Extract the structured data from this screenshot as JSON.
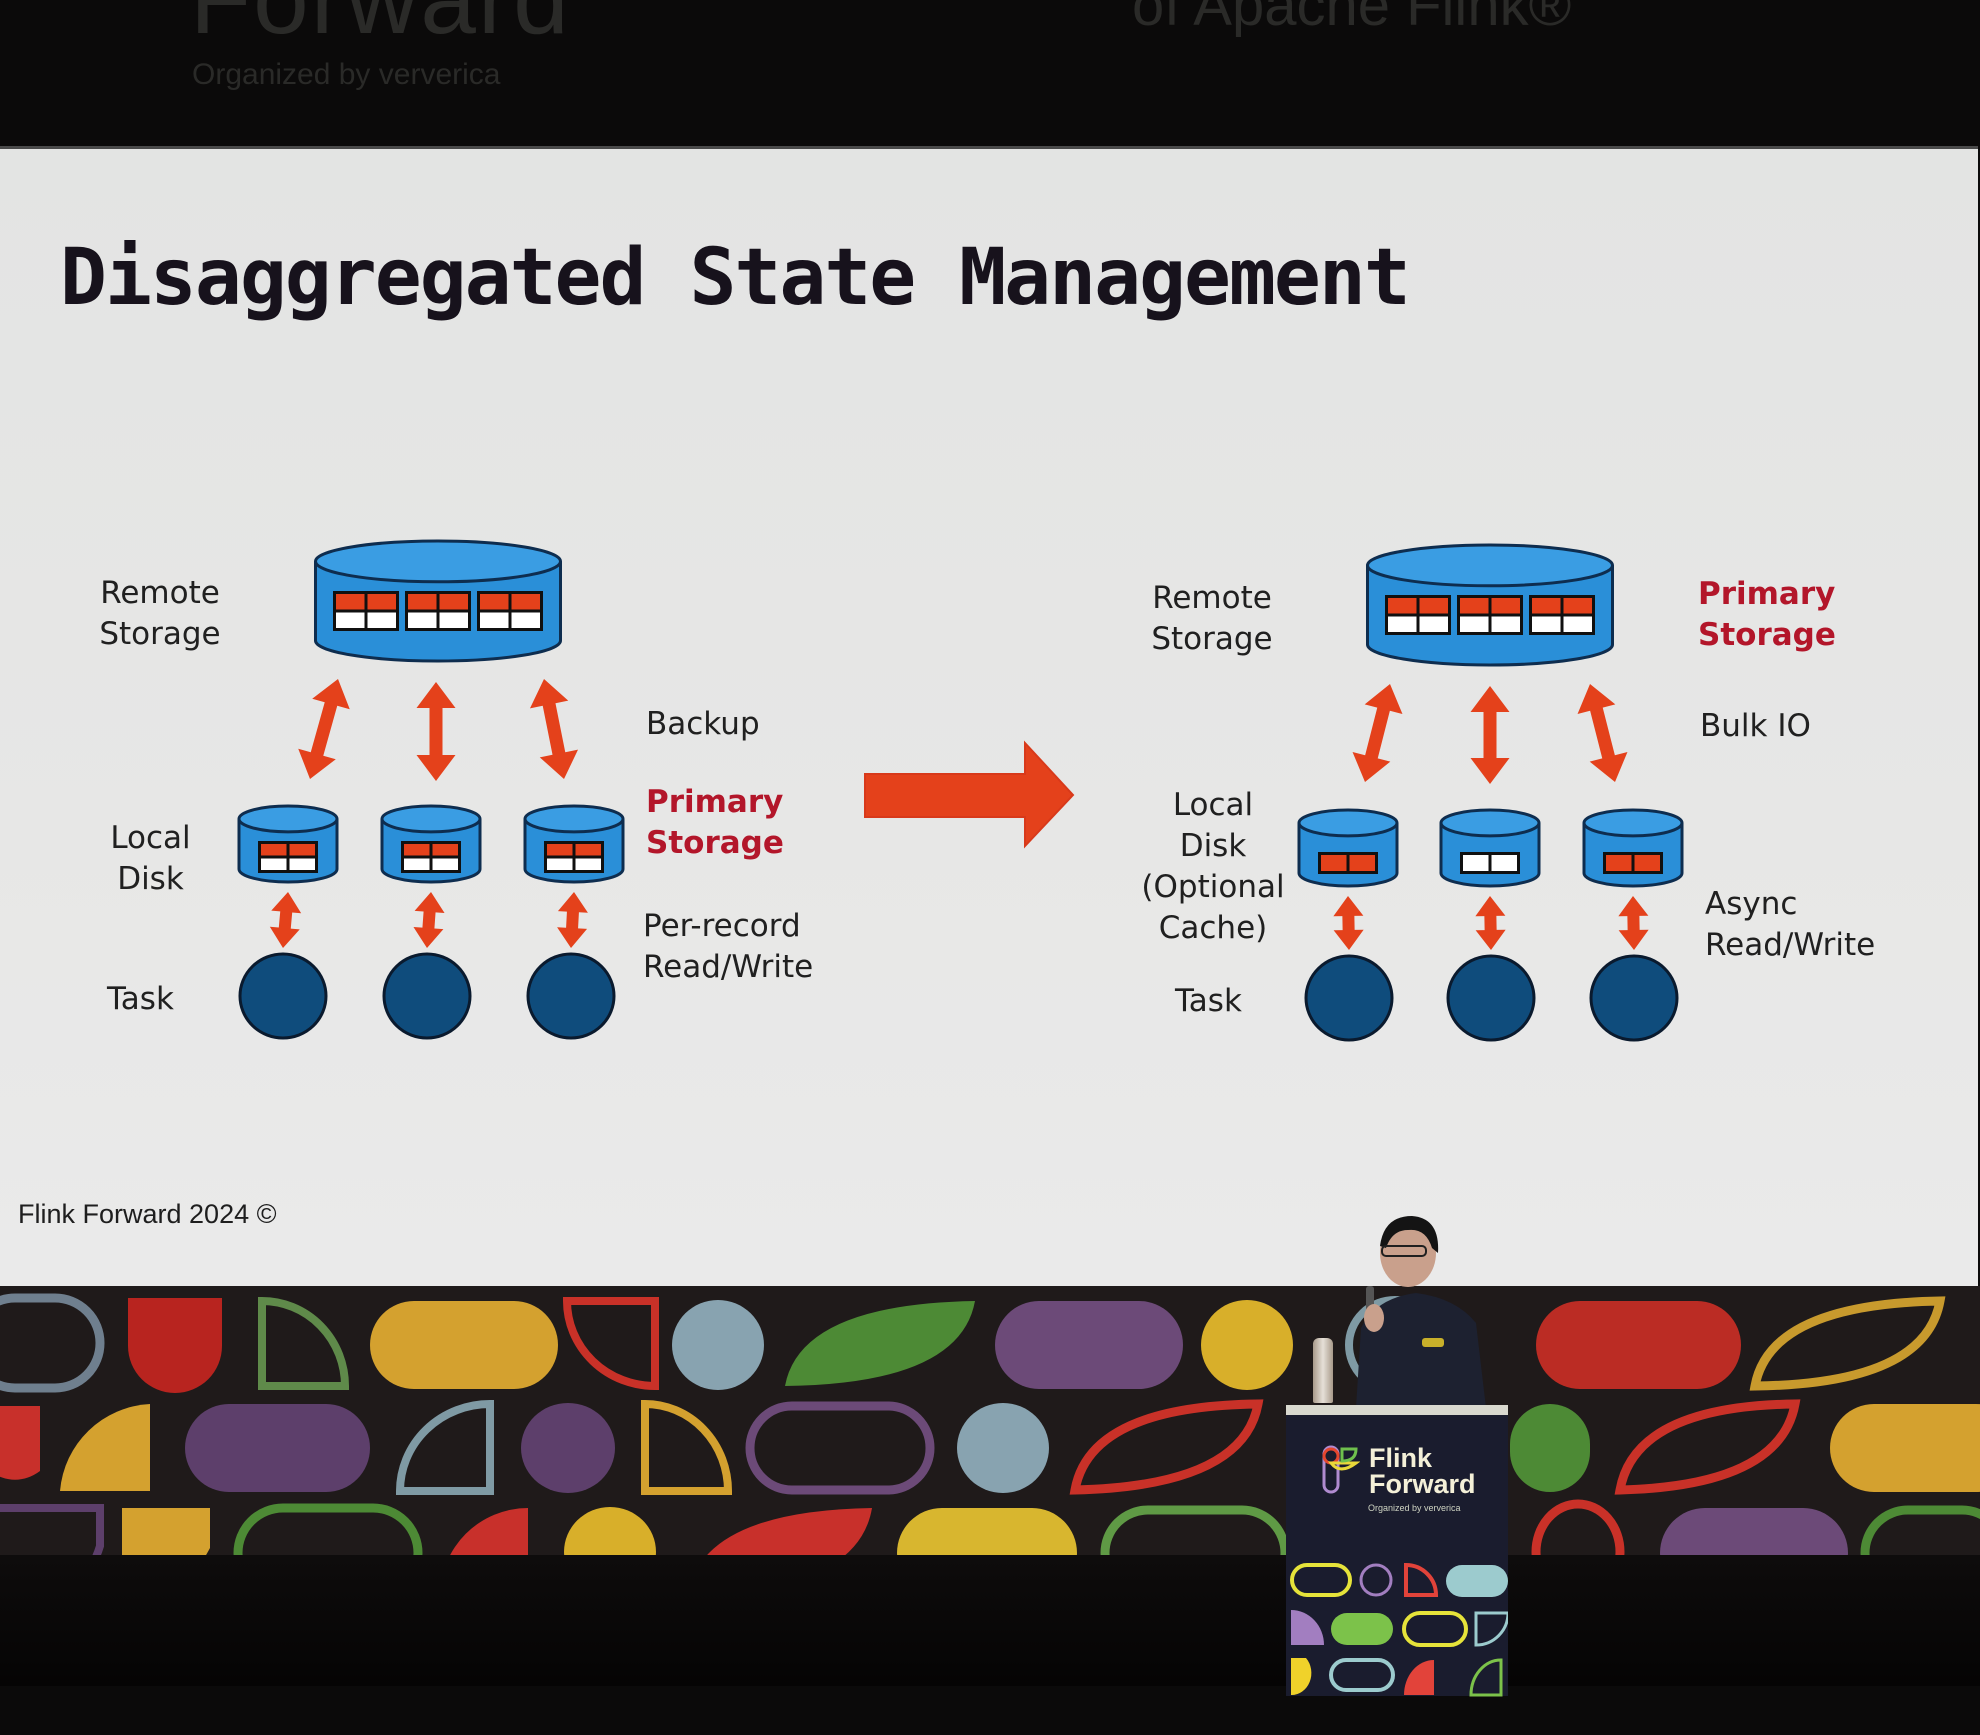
{
  "banner": {
    "event_word": "Forward",
    "organized_by": "Organized by  ververica",
    "tagline_fragment": "of Apache Flink®"
  },
  "slide": {
    "title": "Disaggregated State Management",
    "footer": "Flink Forward 2024 ©",
    "colors": {
      "cylinder_fill": "#2a8fd8",
      "cylinder_stroke": "#0e2d4f",
      "arrow": "#e4411b",
      "task_fill": "#0f4c7c",
      "highlight_text": "#b3162a"
    },
    "left": {
      "remote_storage_label_1": "Remote",
      "remote_storage_label_2": "Storage",
      "backup_label": "Backup",
      "primary_label_1": "Primary",
      "primary_label_2": "Storage",
      "local_disk_label_1": "Local",
      "local_disk_label_2": "Disk",
      "io_label_1": "Per-record",
      "io_label_2": "Read/Write",
      "task_label": "Task",
      "local_disks": [
        {
          "blocks": "red-over-white"
        },
        {
          "blocks": "red-over-white"
        },
        {
          "blocks": "red-over-white"
        }
      ],
      "task_count": 3
    },
    "transition_arrow": "right-arrow",
    "right": {
      "remote_storage_label_1": "Remote",
      "remote_storage_label_2": "Storage",
      "primary_label_1": "Primary",
      "primary_label_2": "Storage",
      "bulk_label": "Bulk IO",
      "local_disk_label_1": "Local",
      "local_disk_label_2": "Disk",
      "local_disk_label_3": "(Optional",
      "local_disk_label_4": "Cache)",
      "io_label_1": "Async",
      "io_label_2": "Read/Write",
      "task_label": "Task",
      "local_disks": [
        {
          "blocks": "red"
        },
        {
          "blocks": "white"
        },
        {
          "blocks": "red"
        }
      ],
      "task_count": 3
    }
  },
  "podium": {
    "logo_line_1": "Flink",
    "logo_line_2": "Forward",
    "organized_by": "Organized by  ververica"
  }
}
